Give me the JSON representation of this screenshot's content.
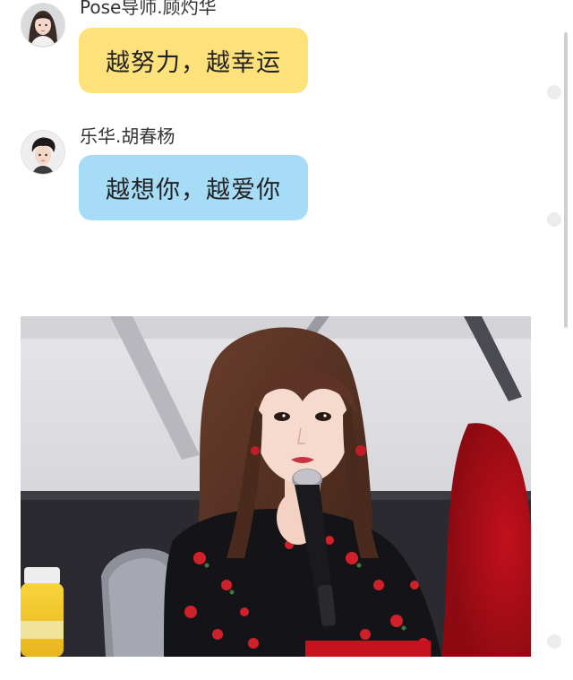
{
  "messages": [
    {
      "sender": "Pose导师.顾灼华",
      "text": "越努力，越幸运",
      "avatar_icon": "avatar-girl-icon",
      "bubble_color": "#fde27b"
    },
    {
      "sender": "乐华.胡春杨",
      "text": "越想你，越爱你",
      "avatar_icon": "avatar-boy-icon",
      "bubble_color": "#a7dcf7"
    }
  ],
  "photo": {
    "subject": "girl-speaking-into-microphone"
  },
  "colors": {
    "yellow_bubble": "#fde27b",
    "blue_bubble": "#a7dcf7",
    "background": "#ffffff"
  }
}
